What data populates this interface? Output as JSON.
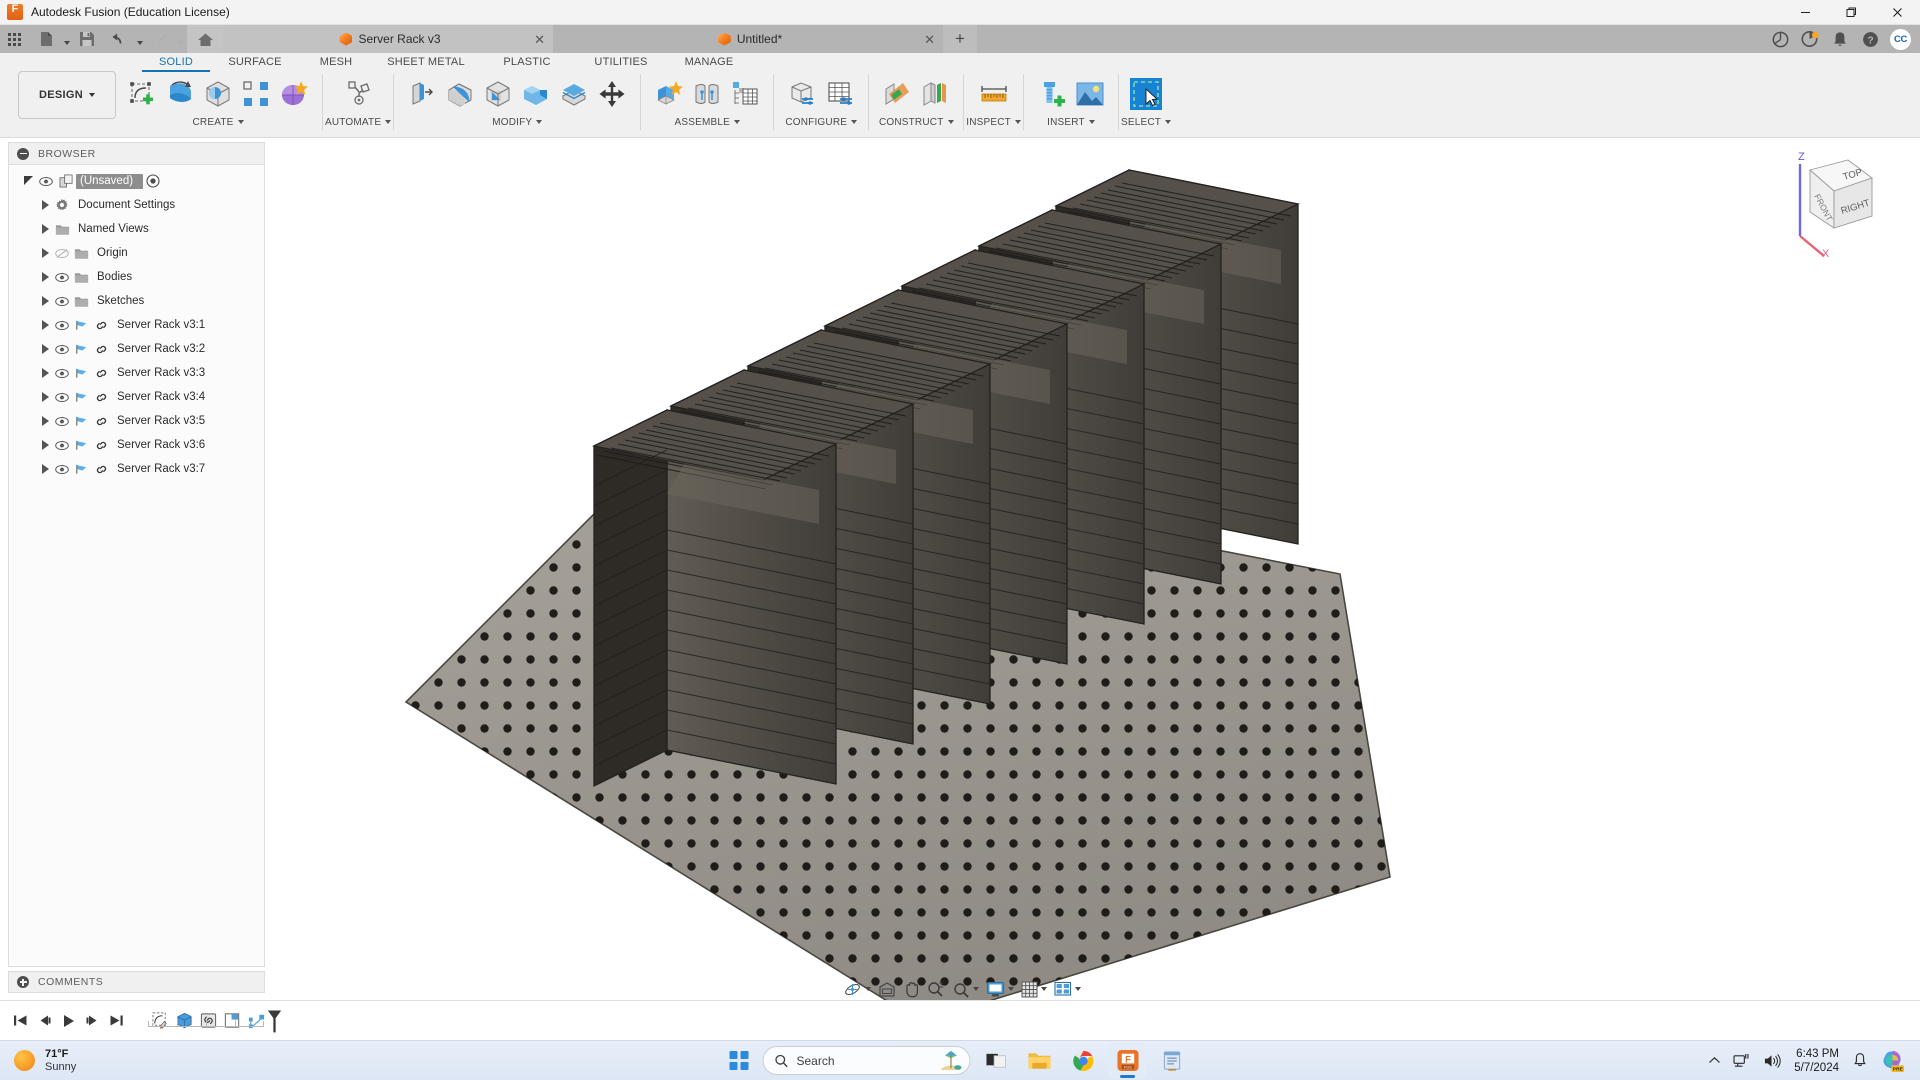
{
  "window": {
    "title": "Autodesk Fusion (Education License)",
    "app_icon": "fusion-logo-icon",
    "controls": {
      "minimize": "—",
      "maximize": "❐",
      "close": "✕"
    }
  },
  "quick_access": {
    "buttons": [
      {
        "name": "app-grid-icon",
        "glyph": "grid"
      },
      {
        "name": "new-document-icon",
        "glyph": "file",
        "caret": true
      },
      {
        "name": "save-icon",
        "glyph": "save"
      },
      {
        "name": "undo-icon",
        "glyph": "undo",
        "caret": true
      },
      {
        "name": "redo-icon",
        "glyph": "redo",
        "caret": true
      },
      {
        "name": "home-icon",
        "glyph": "home"
      }
    ]
  },
  "document_tabs": [
    {
      "label": "Server Rack v3",
      "active": true,
      "close": "✕"
    },
    {
      "label": "Untitled*",
      "active": false,
      "close": "✕"
    }
  ],
  "tab_add_label": "+",
  "titlebar_right_icons": [
    "extension-manager-icon",
    "job-status-icon",
    "notifications-bell-icon",
    "help-icon"
  ],
  "account_avatar": "CC",
  "ribbon": {
    "workspace_button": "DESIGN",
    "tabs": [
      {
        "label": "SOLID",
        "active": true
      },
      {
        "label": "SURFACE",
        "active": false
      },
      {
        "label": "MESH",
        "active": false
      },
      {
        "label": "SHEET METAL",
        "active": false
      },
      {
        "label": "PLASTIC",
        "active": false
      },
      {
        "label": "UTILITIES",
        "active": false
      },
      {
        "label": "MANAGE",
        "active": false
      }
    ],
    "panels": [
      {
        "label": "CREATE",
        "caret": true,
        "tools": [
          "create-sketch-icon",
          "revolve-icon",
          "extrude-icon",
          "pattern-icon",
          "form-icon"
        ]
      },
      {
        "label": "AUTOMATE",
        "caret": true,
        "tools": [
          "automate-icon"
        ]
      },
      {
        "label": "MODIFY",
        "caret": true,
        "tools": [
          "press-pull-icon",
          "fillet-icon",
          "shell-icon",
          "combine-icon",
          "split-face-icon",
          "move-copy-icon"
        ]
      },
      {
        "label": "ASSEMBLE",
        "caret": true,
        "tools": [
          "new-component-icon",
          "joint-icon",
          "bom-icon"
        ]
      },
      {
        "label": "CONFIGURE",
        "caret": true,
        "tools": [
          "configure-component-icon",
          "configure-table-icon"
        ]
      },
      {
        "label": "CONSTRUCT",
        "caret": true,
        "tools": [
          "offset-plane-icon",
          "midplane-icon"
        ]
      },
      {
        "label": "INSPECT",
        "caret": true,
        "tools": [
          "measure-icon"
        ]
      },
      {
        "label": "INSERT",
        "caret": true,
        "tools": [
          "insert-mcmaster-icon",
          "insert-decal-icon"
        ]
      },
      {
        "label": "SELECT",
        "caret": true,
        "tools": [
          "select-window-icon"
        ]
      }
    ]
  },
  "browser": {
    "title": "BROWSER",
    "root": {
      "label": "(Unsaved)",
      "selected": true
    },
    "items": [
      {
        "label": "Document Settings",
        "icon": "gear-icon",
        "has_eye": false,
        "has_flag": false,
        "has_link": false
      },
      {
        "label": "Named Views",
        "icon": "folder-icon",
        "has_eye": false,
        "has_flag": false,
        "has_link": false
      },
      {
        "label": "Origin",
        "icon": "folder-icon",
        "has_eye": true,
        "eye_hidden": true,
        "has_flag": false,
        "has_link": false
      },
      {
        "label": "Bodies",
        "icon": "folder-icon",
        "has_eye": true,
        "eye_hidden": false,
        "has_flag": false,
        "has_link": false
      },
      {
        "label": "Sketches",
        "icon": "folder-icon",
        "has_eye": true,
        "eye_hidden": false,
        "has_flag": false,
        "has_link": false
      },
      {
        "label": "Server Rack v3:1",
        "icon": "component-icon",
        "has_eye": true,
        "eye_hidden": false,
        "has_flag": true,
        "has_link": true
      },
      {
        "label": "Server Rack v3:2",
        "icon": "component-icon",
        "has_eye": true,
        "eye_hidden": false,
        "has_flag": true,
        "has_link": true
      },
      {
        "label": "Server Rack v3:3",
        "icon": "component-icon",
        "has_eye": true,
        "eye_hidden": false,
        "has_flag": true,
        "has_link": true
      },
      {
        "label": "Server Rack v3:4",
        "icon": "component-icon",
        "has_eye": true,
        "eye_hidden": false,
        "has_flag": true,
        "has_link": true
      },
      {
        "label": "Server Rack v3:5",
        "icon": "component-icon",
        "has_eye": true,
        "eye_hidden": false,
        "has_flag": true,
        "has_link": true
      },
      {
        "label": "Server Rack v3:6",
        "icon": "component-icon",
        "has_eye": true,
        "eye_hidden": false,
        "has_flag": true,
        "has_link": true
      },
      {
        "label": "Server Rack v3:7",
        "icon": "component-icon",
        "has_eye": true,
        "eye_hidden": false,
        "has_flag": true,
        "has_link": true
      }
    ]
  },
  "comments": {
    "title": "COMMENTS"
  },
  "viewcube": {
    "faces": {
      "top": "TOP",
      "front": "FRONT",
      "right": "RIGHT"
    },
    "axes": {
      "z": "Z",
      "x": "X"
    },
    "z_color": "#5a5ae8",
    "x_color": "#e8607a"
  },
  "view_navbar": [
    {
      "name": "orbit-icon",
      "caret": true
    },
    {
      "name": "pan-view-icon",
      "caret": false
    },
    {
      "name": "pan-icon",
      "caret": false
    },
    {
      "name": "zoom-icon",
      "caret": false
    },
    {
      "name": "zoom-window-icon",
      "caret": true
    },
    {
      "name": "display-settings-icon",
      "caret": true
    },
    {
      "name": "grid-snaps-icon",
      "caret": true
    },
    {
      "name": "viewports-icon",
      "caret": true
    }
  ],
  "timeline": {
    "playback": [
      "go-to-beginning-icon",
      "step-back-icon",
      "play-icon",
      "step-forward-icon",
      "go-to-end-icon"
    ],
    "features": [
      "sketch-feature-icon",
      "extrude-feature-icon",
      "component-feature-icon",
      "pattern-feature-icon",
      "joint-feature-icon"
    ]
  },
  "taskbar": {
    "weather": {
      "temperature": "71°F",
      "condition": "Sunny"
    },
    "search_placeholder": "Search",
    "apps": [
      {
        "name": "windows-start-icon"
      },
      {
        "name": "task-view-icon"
      },
      {
        "name": "file-explorer-icon"
      },
      {
        "name": "chrome-icon"
      },
      {
        "name": "fusion-taskbar-icon",
        "active": true
      },
      {
        "name": "notepad-icon"
      }
    ],
    "tray": {
      "chevron": "⌃",
      "network_icon": "network-icon",
      "volume_icon": "volume-icon",
      "time": "6:43 PM",
      "date": "5/7/2024",
      "notification_icon": "bell-icon",
      "copilot_icon": "copilot-icon",
      "copilot_badge": "PRE"
    }
  },
  "model": {
    "description": "3D isometric view of seven server rack assemblies standing on a perforated base plate",
    "rack_count": 7,
    "rack_color": "#3d3a36",
    "plate_color": "#9b9790"
  }
}
